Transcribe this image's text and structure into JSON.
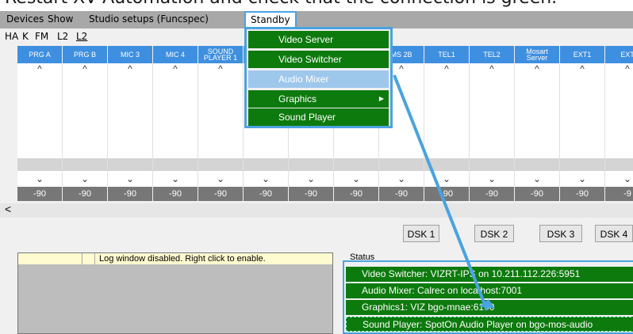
{
  "caption": "Restart XV Automation and check that the connection is green.",
  "menubar": {
    "items": [
      "Devices",
      "Show",
      "Studio setups (Funcspec)"
    ],
    "open_item": "Standby"
  },
  "toolbar": {
    "items": [
      "HA",
      "K",
      "FM",
      "L2"
    ],
    "active_item": "L2"
  },
  "grid": {
    "columns": [
      {
        "header": "PRG A",
        "value": "-90"
      },
      {
        "header": "PRG B",
        "value": "-90"
      },
      {
        "header": "MIC 3",
        "value": "-90"
      },
      {
        "header": "MIC 4",
        "value": "-90"
      },
      {
        "header": "SOUND PLAYER 1",
        "value": "-90"
      },
      {
        "header": "",
        "value": "-90"
      },
      {
        "header": "",
        "value": "-90"
      },
      {
        "header": "",
        "value": "-90"
      },
      {
        "header": "MS 2B",
        "value": "-90"
      },
      {
        "header": "TEL1",
        "value": "-90"
      },
      {
        "header": "TEL2",
        "value": "-90"
      },
      {
        "header": "Mosart Server",
        "value": "-90"
      },
      {
        "header": "EXT1",
        "value": "-90"
      },
      {
        "header": "EXT",
        "value": "-9"
      }
    ],
    "up_glyph": "^",
    "down_glyph": "⌄"
  },
  "scrollbar": {
    "left_arrow": "<"
  },
  "dsk_buttons": [
    "DSK 1",
    "DSK 2",
    "DSK 3",
    "DSK 4"
  ],
  "log": {
    "message": "Log window disabled. Right click to enable."
  },
  "status": {
    "label": "Status",
    "rows": [
      "Video Switcher: VIZRT-IPS on 10.211.112.226:5951",
      "Audio Mixer: Calrec on localhost:7001",
      "Graphics1: VIZ bgo-mnae:6100",
      "Sound Player: SpotOn Audio Player on bgo-mos-audio"
    ]
  },
  "dropdown": {
    "items": [
      "Video Server",
      "Video Switcher",
      "Audio Mixer",
      "Graphics",
      "Sound Player"
    ],
    "highlighted_index": 2,
    "submenu_index": 3,
    "submenu_glyph": "▶"
  },
  "colors": {
    "accent_blue": "#4aa3e0",
    "status_green": "#0d7a0d",
    "header_blue": "#3f8fe0"
  }
}
